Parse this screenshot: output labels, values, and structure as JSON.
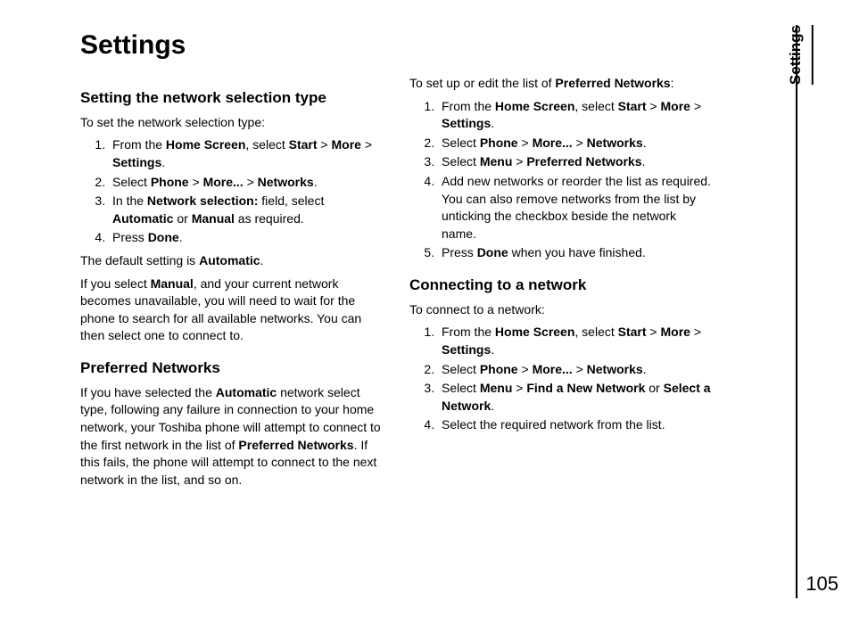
{
  "title": "Settings",
  "sideTab": "Settings",
  "pageNumber": "105",
  "col1": {
    "h2a": "Setting the network selection type",
    "intro_a": "To set the network selection type:",
    "steps_a": {
      "s1_pre": "From the ",
      "s1_b1": "Home Screen",
      "s1_mid1": ", select ",
      "s1_b2": "Start",
      "s1_mid2": " > ",
      "s1_b3": "More",
      "s1_mid3": " > ",
      "s1_b4": "Settings",
      "s1_end": ".",
      "s2_pre": "Select ",
      "s2_b1": "Phone",
      "s2_mid1": " > ",
      "s2_b2": "More...",
      "s2_mid2": " > ",
      "s2_b3": "Networks",
      "s2_end": ".",
      "s3_pre": "In the ",
      "s3_b1": "Network selection:",
      "s3_mid1": " field, select ",
      "s3_b2": "Automatic",
      "s3_mid2": " or ",
      "s3_b3": "Manual",
      "s3_end": " as required.",
      "s4_pre": "Press ",
      "s4_b1": "Done",
      "s4_end": "."
    },
    "after_a1_pre": "The default setting is ",
    "after_a1_b": "Automatic",
    "after_a1_end": ".",
    "after_a2_pre": "If you select ",
    "after_a2_b": "Manual",
    "after_a2_end": ", and your current network becomes unavailable, you will need to wait for the phone to search for all available networks. You can then select one to connect to.",
    "h2b": "Preferred Networks",
    "para_b_pre": "If you have selected the ",
    "para_b_b1": "Automatic",
    "para_b_mid": " network select type, following any failure in connection to your home network, your Toshiba phone will attempt to connect to the first network in the list of ",
    "para_b_b2": "Preferred Networks",
    "para_b_end": ". If this fails, the phone will attempt to connect to the next network in the list, and so on."
  },
  "col2": {
    "intro_c_pre": "To set up or edit the list of ",
    "intro_c_b": "Preferred Networks",
    "intro_c_end": ":",
    "steps_c": {
      "s1_pre": "From the ",
      "s1_b1": "Home Screen",
      "s1_mid1": ", select ",
      "s1_b2": "Start",
      "s1_mid2": " > ",
      "s1_b3": "More",
      "s1_mid3": " > ",
      "s1_b4": "Settings",
      "s1_end": ".",
      "s2_pre": "Select ",
      "s2_b1": "Phone",
      "s2_mid1": " > ",
      "s2_b2": "More...",
      "s2_mid2": " > ",
      "s2_b3": "Networks",
      "s2_end": ".",
      "s3_pre": "Select ",
      "s3_b1": "Menu",
      "s3_mid1": " > ",
      "s3_b2": "Preferred Networks",
      "s3_end": ".",
      "s4": "Add new networks or reorder the list as required. You can also remove networks from the list by unticking the checkbox beside the network name.",
      "s5_pre": "Press ",
      "s5_b1": "Done",
      "s5_end": " when you have finished."
    },
    "h2d": "Connecting to a network",
    "intro_d": "To connect to a network:",
    "steps_d": {
      "s1_pre": "From the ",
      "s1_b1": "Home Screen",
      "s1_mid1": ", select ",
      "s1_b2": "Start",
      "s1_mid2": " > ",
      "s1_b3": "More",
      "s1_mid3": " > ",
      "s1_b4": "Settings",
      "s1_end": ".",
      "s2_pre": "Select ",
      "s2_b1": "Phone",
      "s2_mid1": " > ",
      "s2_b2": "More...",
      "s2_mid2": " > ",
      "s2_b3": "Networks",
      "s2_end": ".",
      "s3_pre": "Select ",
      "s3_b1": "Menu",
      "s3_mid1": " > ",
      "s3_b2": "Find a New Network",
      "s3_mid2": " or ",
      "s3_b3": "Select a Network",
      "s3_end": ".",
      "s4": "Select the required network from the list."
    }
  }
}
